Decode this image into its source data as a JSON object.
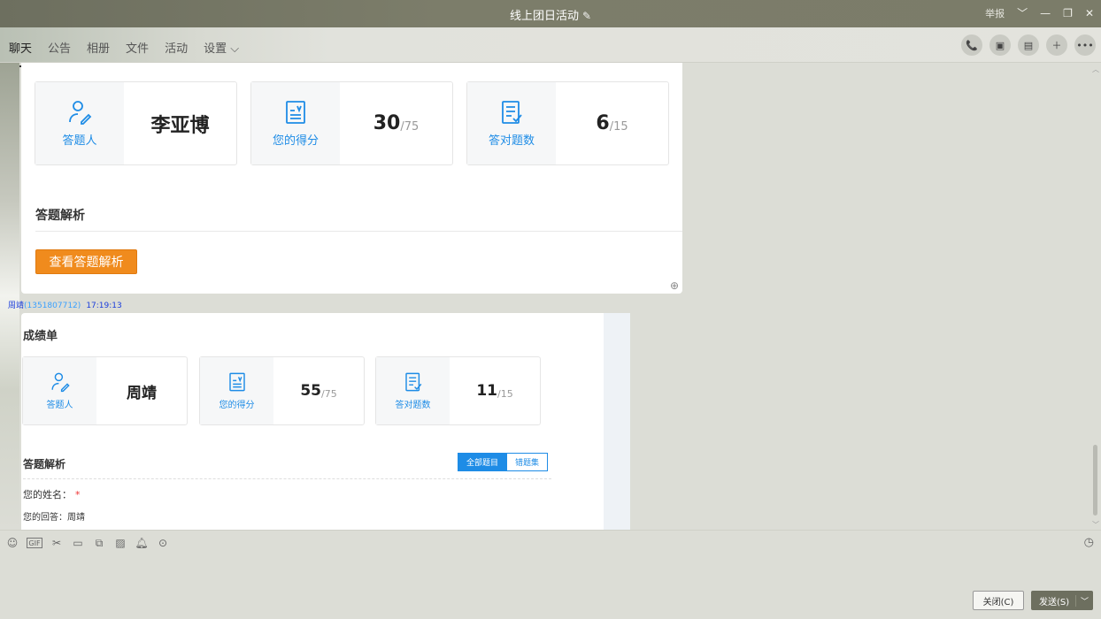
{
  "window": {
    "title": "线上团日活动",
    "edit_icon": "pencil-icon",
    "report": "举报",
    "controls": [
      "﹀",
      "—",
      "❐",
      "✕"
    ]
  },
  "tabs": [
    {
      "label": "聊天",
      "active": true
    },
    {
      "label": "公告"
    },
    {
      "label": "相册"
    },
    {
      "label": "文件"
    },
    {
      "label": "活动"
    },
    {
      "label": "设置 ⌵"
    }
  ],
  "toolbar_icons": [
    "phone-icon",
    "video-icon",
    "screen-share-icon",
    "add-icon",
    "more-icon"
  ],
  "card1": {
    "respondent_label": "答题人",
    "respondent_name": "李亚博",
    "score_label": "您的得分",
    "score": "30",
    "score_total": "/75",
    "correct_label": "答对题数",
    "correct": "6",
    "correct_total": "/15",
    "analysis_title": "答题解析",
    "analysis_button": "查看答题解析"
  },
  "sender": {
    "name": "周靖",
    "qq": "(1351807712)",
    "time": "17:19:13"
  },
  "card2": {
    "title": "成绩单",
    "respondent_label": "答题人",
    "respondent_name": "周靖",
    "score_label": "您的得分",
    "score": "55",
    "score_total": "/75",
    "correct_label": "答对题数",
    "correct": "11",
    "correct_total": "/15",
    "analysis_title": "答题解析",
    "seg_all": "全部题目",
    "seg_wrong": "错题集",
    "question": "您的姓名：",
    "required_mark": "*",
    "answer": "您的回答：周靖"
  },
  "input_tools": [
    "emoji-icon",
    "gif-icon",
    "scissors-icon",
    "folder-icon",
    "doc-icon",
    "image-icon",
    "bell-icon",
    "more-circle-icon"
  ],
  "buttons": {
    "close": "关闭(C)",
    "send": "发送(S)"
  },
  "colors": {
    "accent_blue": "#1e8ce6",
    "orange": "#f08b1d",
    "titlebar": "#6d6f5f"
  }
}
